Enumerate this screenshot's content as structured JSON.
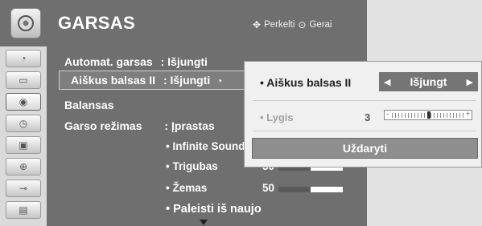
{
  "header": {
    "title": "GARSAS",
    "hint_move_icon": "dpad-icon",
    "hint_move": "Perkelti",
    "hint_ok_icon": "ok-button-icon",
    "hint_ok": "Gerai"
  },
  "sidebar": {
    "items": [
      {
        "icon": "picture-icon",
        "glyph": "◔",
        "active": false
      },
      {
        "icon": "screen-icon",
        "glyph": "▭",
        "active": false
      },
      {
        "icon": "audio-icon",
        "glyph": "◉",
        "active": true
      },
      {
        "icon": "clock-icon",
        "glyph": "◷",
        "active": false
      },
      {
        "icon": "option-icon",
        "glyph": "▣",
        "active": false
      },
      {
        "icon": "lock-icon",
        "glyph": "⊕",
        "active": false
      },
      {
        "icon": "input-icon",
        "glyph": "⊸",
        "active": false
      },
      {
        "icon": "movie-icon",
        "glyph": "▤",
        "active": false
      }
    ]
  },
  "menu": {
    "auto_volume_label": "Automat. garsas",
    "auto_volume_value": ": Išjungti",
    "clear_voice_label": "Aiškus balsas II",
    "clear_voice_value": ": Išjungti",
    "balance_label": "Balansas",
    "sound_mode_label": "Garso režimas",
    "sound_mode_value": ": Įprastas",
    "infinite_sound_label": "• Infinite Sound",
    "treble_label": "• Trigubas",
    "treble_value": "50",
    "bass_label": "• Žemas",
    "bass_value": "50",
    "reset_label": "• Paleisti iš naujo"
  },
  "bars": {
    "treble_level": 50,
    "bass_level": 50
  },
  "popup": {
    "clear_voice_label": "• Aiškus balsas II",
    "clear_voice_value": "Išjungt",
    "level_label": "• Lygis",
    "level_value": "3",
    "level_slider_fraction": 0.5,
    "slider_minus": "-",
    "slider_plus": "+",
    "close_button": "Uždaryti"
  }
}
